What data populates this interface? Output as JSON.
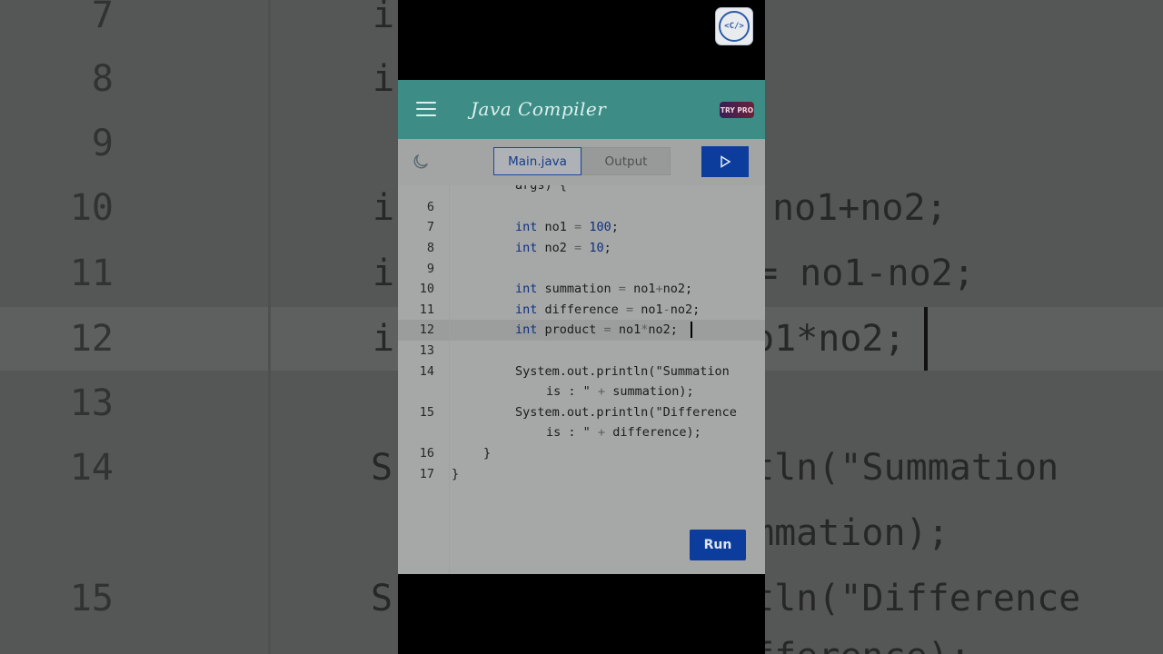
{
  "app": {
    "title": "Java Compiler",
    "try_pro": "TRY PRO",
    "menu_icon": "hamburger-menu-icon",
    "theme_icon": "moon-icon",
    "logo_text": "<C/>"
  },
  "tabs": [
    {
      "label": "Main.java",
      "active": true
    },
    {
      "label": "Output",
      "active": false
    }
  ],
  "run_label": "Run",
  "editor": {
    "partial_line": "args) {",
    "lines": [
      {
        "n": "6",
        "text": ""
      },
      {
        "n": "7",
        "text": "int no1 = 100;"
      },
      {
        "n": "8",
        "text": "int no2 = 10;"
      },
      {
        "n": "9",
        "text": ""
      },
      {
        "n": "10",
        "text": "int summation = no1+no2;"
      },
      {
        "n": "11",
        "text": "int difference = no1-no2;"
      },
      {
        "n": "12",
        "text": "int product = no1*no2;"
      },
      {
        "n": "13",
        "text": ""
      },
      {
        "n": "14",
        "text": "System.out.println(\"Summation is : \" + summation);"
      },
      {
        "n": "15",
        "text": "System.out.println(\"Difference is : \" + difference);"
      },
      {
        "n": "16",
        "text": "}"
      },
      {
        "n": "17",
        "text": "}"
      }
    ],
    "current_line": "12"
  },
  "background_zoom": {
    "left_numbers": [
      "7",
      "8",
      "9",
      "10",
      "11",
      "12",
      "13",
      "14",
      "15"
    ],
    "left_code_fragments": [
      "i",
      "i",
      "i",
      "i",
      "i",
      "S",
      "S"
    ],
    "right_code_fragments": [
      "no1+no2;",
      "= no1-no2;",
      "o1*no2;",
      "tln(\"Summation",
      "mmation);",
      "tln(\"Difference",
      "fference);"
    ]
  },
  "colors": {
    "appbar": "#3d8d86",
    "accent": "#0c3c9c",
    "editor_bg": "#a5a8a7"
  }
}
